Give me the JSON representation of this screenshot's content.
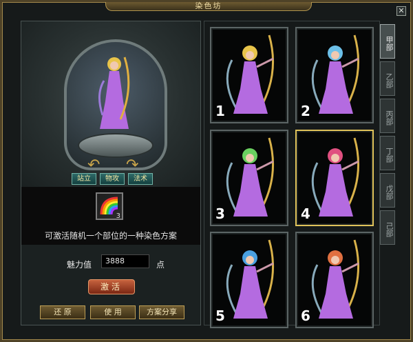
{
  "window": {
    "title": "染色坊",
    "close_glyph": "✕"
  },
  "preview": {
    "pose_buttons": [
      "站立",
      "物攻",
      "法术"
    ]
  },
  "item": {
    "icon": "rainbow-dye-icon",
    "quantity": "3",
    "description": "可激活随机一个部位的一种染色方案"
  },
  "charm": {
    "label": "魅力值",
    "value": "3888",
    "unit": "点"
  },
  "actions": {
    "activate": "激活",
    "restore": "还 原",
    "use": "使 用",
    "share": "方案分享"
  },
  "schemes": [
    {
      "number": "1",
      "hair": "#e8c44a"
    },
    {
      "number": "2",
      "hair": "#6cc0e8"
    },
    {
      "number": "3",
      "hair": "#6ad060"
    },
    {
      "number": "4",
      "hair": "#e05080",
      "selected": true
    },
    {
      "number": "5",
      "hair": "#4aa0e0"
    },
    {
      "number": "6",
      "hair": "#e07040"
    }
  ],
  "tabs": [
    "甲部",
    "乙部",
    "丙部",
    "丁部",
    "戊部",
    "己部"
  ],
  "colors": {
    "frame_gold": "#a48a4c",
    "selected_border": "#e0c35a",
    "teal_button": "#2e6a68",
    "activate_red": "#c6623e"
  }
}
